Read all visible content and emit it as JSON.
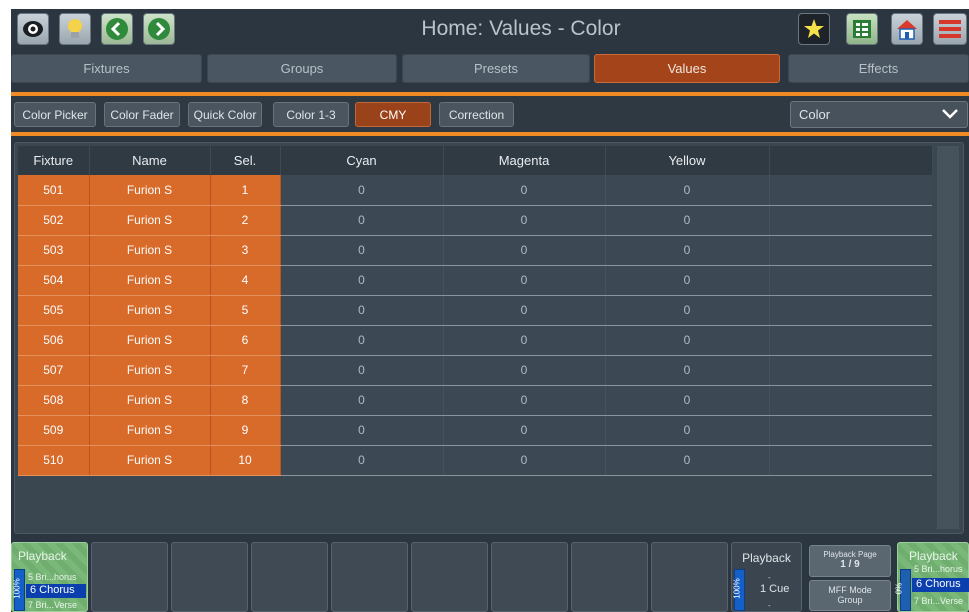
{
  "title": "Home: Values - Color",
  "toolbar_left": [
    {
      "icon": "eye-icon"
    },
    {
      "icon": "lightbulb-icon"
    },
    {
      "icon": "chevron-left-icon"
    },
    {
      "icon": "chevron-right-icon"
    }
  ],
  "toolbar_right": [
    {
      "icon": "magic-wand-icon"
    },
    {
      "icon": "grid-view-icon"
    },
    {
      "icon": "home-icon"
    },
    {
      "icon": "menu-icon"
    }
  ],
  "tabs": [
    {
      "label": "Fixtures"
    },
    {
      "label": "Groups"
    },
    {
      "label": "Presets"
    },
    {
      "label": "Values",
      "active": true
    },
    {
      "label": "Effects"
    }
  ],
  "subtabs": [
    {
      "label": "Color Picker"
    },
    {
      "label": "Color Fader"
    },
    {
      "label": "Quick Color"
    },
    {
      "label": "Color 1-3"
    },
    {
      "label": "CMY",
      "active": true
    },
    {
      "label": "Correction"
    }
  ],
  "select": {
    "value": "Color"
  },
  "table": {
    "headers": [
      "Fixture",
      "Name",
      "Sel.",
      "Cyan",
      "Magenta",
      "Yellow",
      ""
    ],
    "rows": [
      {
        "fixture": "501",
        "name": "Furion S",
        "sel": "1",
        "cyan": "0",
        "magenta": "0",
        "yellow": "0"
      },
      {
        "fixture": "502",
        "name": "Furion S",
        "sel": "2",
        "cyan": "0",
        "magenta": "0",
        "yellow": "0"
      },
      {
        "fixture": "503",
        "name": "Furion S",
        "sel": "3",
        "cyan": "0",
        "magenta": "0",
        "yellow": "0"
      },
      {
        "fixture": "504",
        "name": "Furion S",
        "sel": "4",
        "cyan": "0",
        "magenta": "0",
        "yellow": "0"
      },
      {
        "fixture": "505",
        "name": "Furion S",
        "sel": "5",
        "cyan": "0",
        "magenta": "0",
        "yellow": "0"
      },
      {
        "fixture": "506",
        "name": "Furion S",
        "sel": "6",
        "cyan": "0",
        "magenta": "0",
        "yellow": "0"
      },
      {
        "fixture": "507",
        "name": "Furion S",
        "sel": "7",
        "cyan": "0",
        "magenta": "0",
        "yellow": "0"
      },
      {
        "fixture": "508",
        "name": "Furion S",
        "sel": "8",
        "cyan": "0",
        "magenta": "0",
        "yellow": "0"
      },
      {
        "fixture": "509",
        "name": "Furion S",
        "sel": "9",
        "cyan": "0",
        "magenta": "0",
        "yellow": "0"
      },
      {
        "fixture": "510",
        "name": "Furion S",
        "sel": "10",
        "cyan": "0",
        "magenta": "0",
        "yellow": "0"
      }
    ]
  },
  "playback_left": {
    "title": "Playback",
    "level": "100%",
    "prev": "5 Bri...horus",
    "current": "6 Chorus",
    "next": "7 Bri...Verse"
  },
  "playback_mid": {
    "title": "Playback",
    "level": "100%",
    "above": "-",
    "cue": "1 Cue",
    "below": "-"
  },
  "playback_page": {
    "label": "Playback Page",
    "value": "1 / 9"
  },
  "mff_mode": {
    "label": "MFF Mode",
    "value": "Group"
  },
  "playback_right": {
    "title": "Playback",
    "level": "0%",
    "prev": "5 Bri...horus",
    "current": "6 Chorus",
    "next": "7 Bri...Verse"
  },
  "colors": {
    "accent": "#f08a24",
    "selected_cell": "#d86a2a",
    "active_tab": "#a3441a",
    "background": "#2c3640",
    "playback_green": "#7ab87a",
    "level_blue": "#1560c8"
  }
}
